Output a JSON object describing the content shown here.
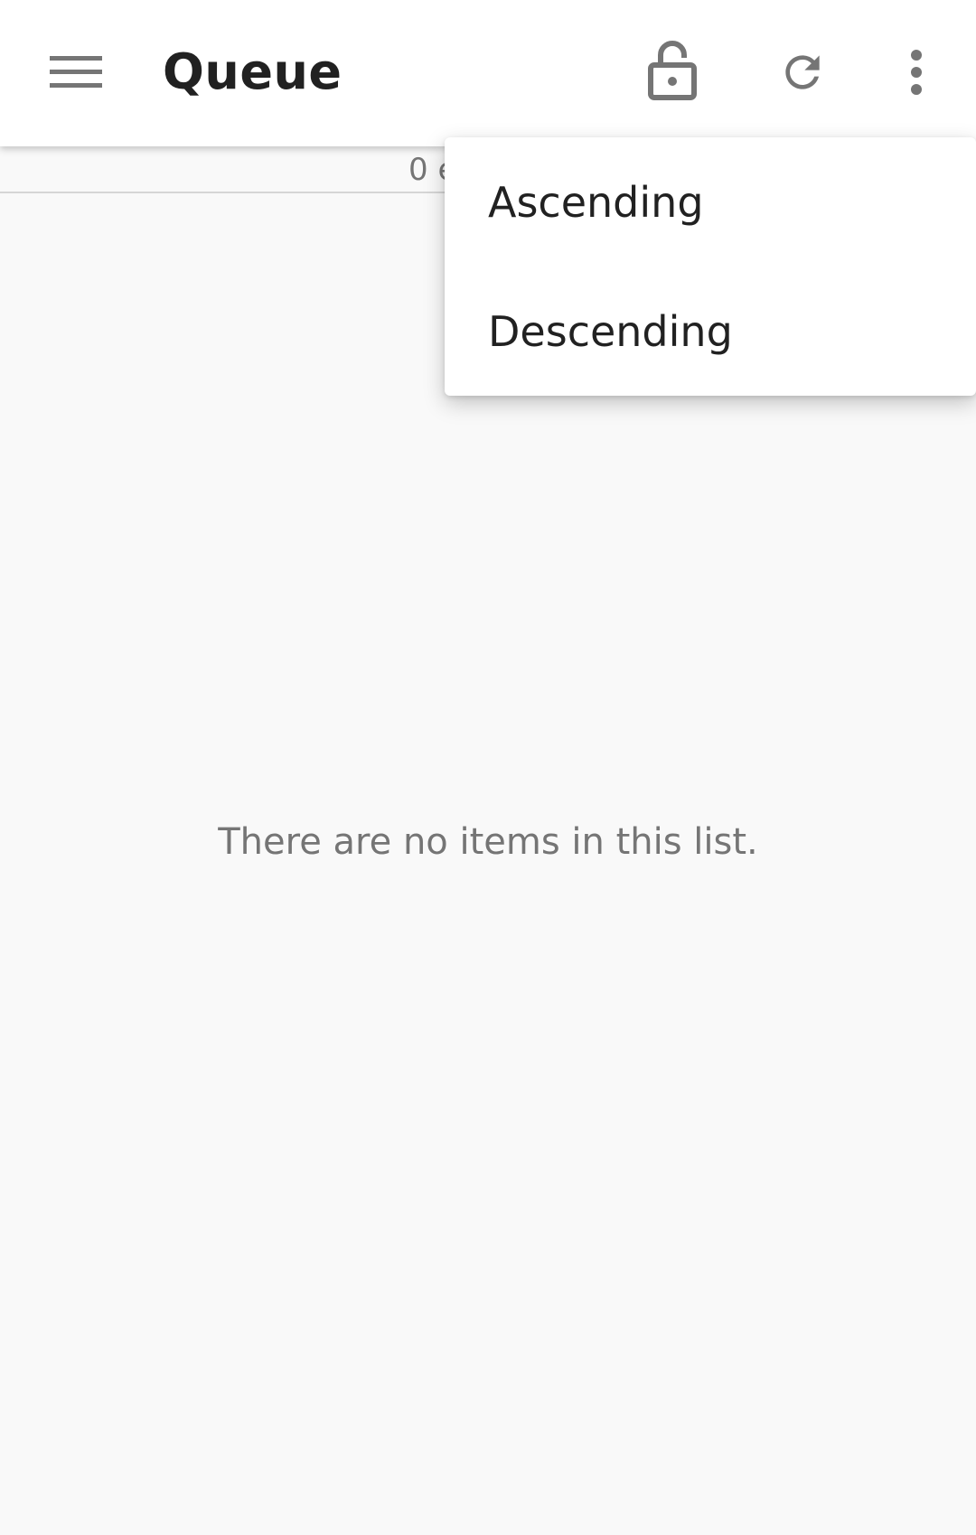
{
  "toolbar": {
    "title": "Queue",
    "icons": [
      "menu-icon",
      "lock-open-icon",
      "refresh-icon",
      "more-vert-icon"
    ]
  },
  "subheader": {
    "text": "0 e"
  },
  "empty_state": {
    "text": "There are no items in this list."
  },
  "sort_menu": {
    "items": [
      {
        "label": "Ascending"
      },
      {
        "label": "Descending"
      }
    ]
  },
  "colors": {
    "background": "#f9f9f9",
    "toolbar": "#ffffff",
    "icon": "#757575",
    "text_primary": "#212121",
    "text_secondary": "#757575"
  }
}
